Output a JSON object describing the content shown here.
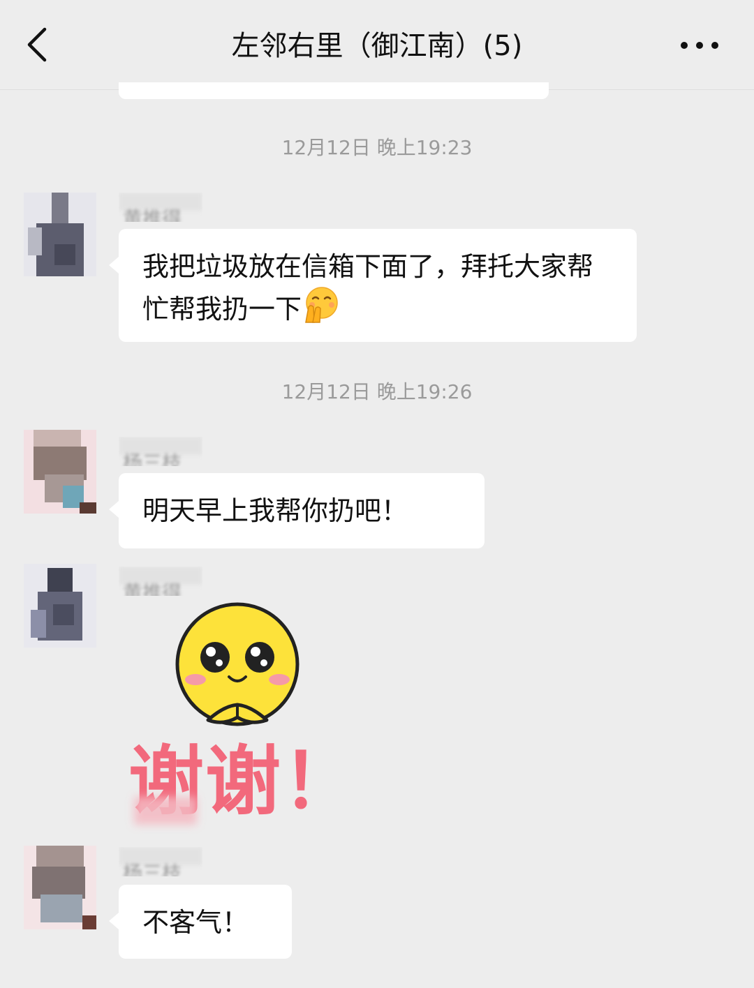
{
  "header": {
    "title": "左邻右里（御江南）(5)",
    "back_icon": "chevron-left-icon",
    "more_icon": "more-horizontal-icon"
  },
  "messages": [
    {
      "timestamp": "12月12日 晚上19:23",
      "sender": "黄推得",
      "text": "我把垃圾放在信箱下面了，拜托大家帮忙帮我扔一下",
      "trailing_icon": "hand-over-mouth-emoji"
    },
    {
      "timestamp": "12月12日 晚上19:26",
      "sender": "杨三枝",
      "text": "明天早上我帮你扔吧！"
    },
    {
      "sender": "黄推得",
      "sticker_text": "谢谢！",
      "sticker_icon": "smiley-thank-you-sticker"
    },
    {
      "sender": "杨三枝",
      "text": "不客气！"
    }
  ],
  "colors": {
    "background": "#ededed",
    "bubble": "#ffffff",
    "timestamp": "#9a9a9a",
    "sticker_text": "#f2697c",
    "sticker_face": "#ffe13a"
  }
}
